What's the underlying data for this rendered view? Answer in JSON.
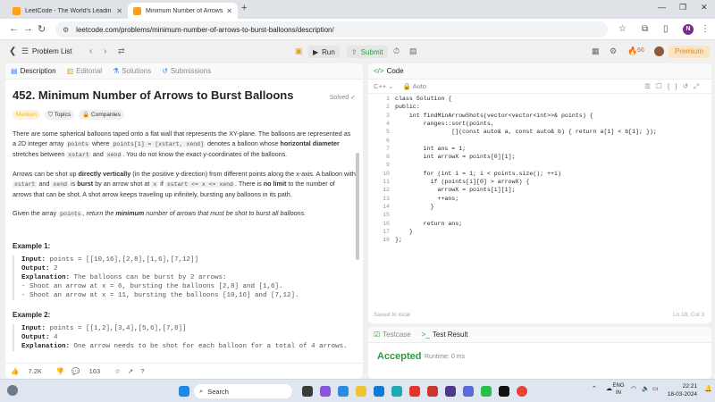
{
  "browser": {
    "tabs": [
      {
        "label": "LeetCode - The World's Leadin",
        "active": false
      },
      {
        "label": "Minimum Number of Arrows to",
        "active": true
      }
    ],
    "url": "leetcode.com/problems/minimum-number-of-arrows-to-burst-balloons/description/",
    "profile_initial": "N"
  },
  "lcnav": {
    "problem_list": "Problem List",
    "run": "Run",
    "submit": "Submit",
    "streak": "66",
    "premium": "Premium"
  },
  "left_tabs": [
    "Description",
    "Editorial",
    "Solutions",
    "Submissions"
  ],
  "problem": {
    "title": "452. Minimum Number of Arrows to Burst Balloons",
    "status": "Solved",
    "chips": [
      "Medium",
      "Topics",
      "Companies"
    ],
    "p1": [
      "There are some spherical balloons taped onto a flat wall that represents the XY-plane. The balloons are represented",
      "as a 2D integer array",
      "points",
      "where",
      "points[i] = [xstart, xend]",
      "denotes a balloon whose",
      "horizontal diameter",
      "stretches between",
      "xstart",
      "and",
      "xend",
      ". You do not know the exact y-coordinates of the balloons."
    ],
    "p2": [
      "Arrows can be shot up",
      "directly vertically",
      "(in the positive y-direction) from different points along the x-axis. A",
      "balloon with",
      "xstart",
      "and",
      "xend",
      "is",
      "burst",
      "by an arrow shot at",
      "x",
      "if",
      "xstart <= x <= xend",
      ". There is",
      "no limit",
      "to the number",
      "of arrows that can be shot. A shot arrow keeps traveling up infinitely, bursting any balloons in its path."
    ],
    "p3": [
      "Given the array",
      "points",
      ", return",
      "the",
      "minimum",
      "number of arrows that must be shot to burst all balloons."
    ],
    "examples": [
      {
        "heading": "Example 1:",
        "input": "points = [[10,16],[2,8],[1,6],[7,12]]",
        "output": "2",
        "explanation": "The balloons can be burst by 2 arrows:",
        "extra": [
          "- Shoot an arrow at x = 6, bursting the balloons [2,8] and [1,6].",
          "- Shoot an arrow at x = 11, bursting the balloons [10,16] and [7,12]."
        ]
      },
      {
        "heading": "Example 2:",
        "input": "points = [[1,2],[3,4],[5,6],[7,8]]",
        "output": "4",
        "explanation": "One arrow needs to be shot for each balloon for a total of 4 arrows.",
        "extra": []
      }
    ],
    "labels": {
      "input": "Input:",
      "output": "Output:",
      "explanation": "Explanation:"
    },
    "likes": "7.2K",
    "comments": "163"
  },
  "editor": {
    "tab_label": "Code",
    "language": "C++",
    "mode": "Auto",
    "saved": "Saved to local",
    "cursor": "Ln 18, Col 3",
    "lines": [
      "class Solution {",
      "public:",
      "    int findMinArrowShots(vector<vector<int>>& points) {",
      "        ranges::sort(points,",
      "                [](const auto& a, const auto& b) { return a[1] < b[1]; });",
      "",
      "        int ans = 1;",
      "        int arrowX = points[0][1];",
      "",
      "        for (int i = 1; i < points.size(); ++i)",
      "          if (points[i][0] > arrowX) {",
      "            arrowX = points[i][1];",
      "            ++ans;",
      "          }",
      "",
      "        return ans;",
      "    }",
      "};"
    ]
  },
  "result": {
    "tabs": [
      "Testcase",
      "Test Result"
    ],
    "status": "Accepted",
    "runtime": "Runtime: 0 ms"
  },
  "taskbar": {
    "search": "Search",
    "lang": [
      "ENG",
      "IN"
    ],
    "time": "22:21",
    "date": "18-03-2024"
  }
}
